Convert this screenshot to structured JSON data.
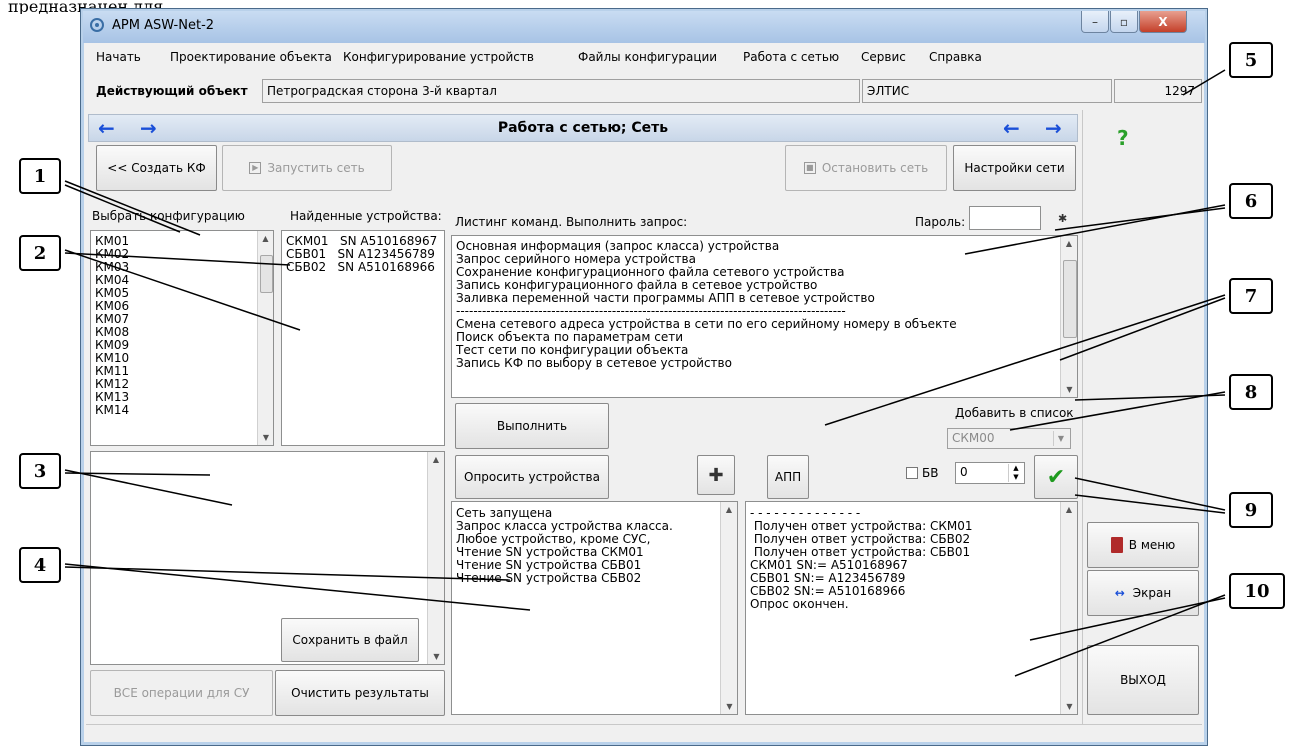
{
  "caption_top": "предназначен для ...",
  "window": {
    "title": "АРМ ASW-Net-2",
    "controls": [
      "–",
      "▫",
      "X"
    ]
  },
  "menu": [
    "Начать",
    "Проектирование объекта",
    "Конфигурирование устройств",
    "Файлы конфигурации",
    "Работа с сетью",
    "Сервис",
    "Справка"
  ],
  "object_bar": {
    "label": "Действующий объект",
    "name": "Петроградская сторона 3-й квартал",
    "org": "ЭЛТИС",
    "number": "1297"
  },
  "header": {
    "title": "Работа с сетью; Сеть",
    "left_arrows": [
      "←",
      "→"
    ],
    "right_arrows": [
      "←",
      "→"
    ]
  },
  "help_icon": "?",
  "toolbar": {
    "create_kf": "<< Создать КФ",
    "start_net": "Запустить сеть",
    "stop_net": "Остановить сеть",
    "net_settings": "Настройки сети"
  },
  "config_list": {
    "label": "Выбрать конфигурацию",
    "items": [
      "КМ01",
      "КМ02",
      "КМ03",
      "КМ04",
      "КМ05",
      "КМ06",
      "КМ07",
      "КМ08",
      "КМ09",
      "КМ10",
      "КМ11",
      "КМ12",
      "КМ13",
      "КМ14"
    ]
  },
  "found_devices": {
    "label": "Найденные устройства:",
    "items": [
      "СКМ01   SN A510168967",
      "СБВ01   SN A123456789",
      "СБВ02   SN A510168966"
    ]
  },
  "commands": {
    "label": "Листинг команд. Выполнить запрос:",
    "password_label": "Пароль:",
    "items": [
      "Основная информация (запрос класса) устройства",
      "Запрос серийного номера устройства",
      "Сохранение конфигурационного файла сетевого устройства",
      "Запись конфигурационного файла в сетевое устройство",
      "Заливка переменной части программы АПП в сетевое устройство",
      "------------------------------------------------------------------------------------------",
      "Смена сетевого адреса устройства в сети по его серийному номеру в объекте",
      "Поиск объекта по параметрам сети",
      "Тест сети по конфигурации объекта",
      "Запись КФ по выбору в сетевое устройство"
    ]
  },
  "execute_button": "Выполнить",
  "add_to_list": {
    "label": "Добавить в список",
    "value": "СКМ00"
  },
  "poll_button": "Опросить устройства",
  "plus_icon": "✚",
  "app_button": "АПП",
  "bv": {
    "label": "БВ",
    "value": "0"
  },
  "ok_icon": "✔",
  "log_left": [
    "Сеть запущена",
    "Запрос класса устройства класса.",
    "Любое устройство, кроме СУС,",
    "Чтение SN устройства СКМ01",
    "Чтение SN устройства СБВ01",
    "Чтение SN устройства СБВ02"
  ],
  "log_right": [
    "- - - - - - - - - - - - - -",
    " Получен ответ устройства: СКМ01",
    " Получен ответ устройства: СБВ02",
    " Получен ответ устройства: СБВ01",
    "СКМ01 SN:= A510168967",
    "СБВ01 SN:= A123456789",
    "СБВ02 SN:= A510168966",
    "Опрос окончен."
  ],
  "save_file": "Сохранить в файл",
  "all_ops": "ВСЕ операции для СУ",
  "clear_results": "Очистить результаты",
  "side": {
    "to_menu": "В меню",
    "screen": "Экран",
    "exit": "ВЫХОД"
  },
  "callouts": [
    "1",
    "2",
    "3",
    "4",
    "5",
    "6",
    "7",
    "8",
    "9",
    "10"
  ],
  "colors": {
    "arrow": "#1a4fd8",
    "help": "#2aa02a",
    "ok": "#1e9a1e"
  }
}
